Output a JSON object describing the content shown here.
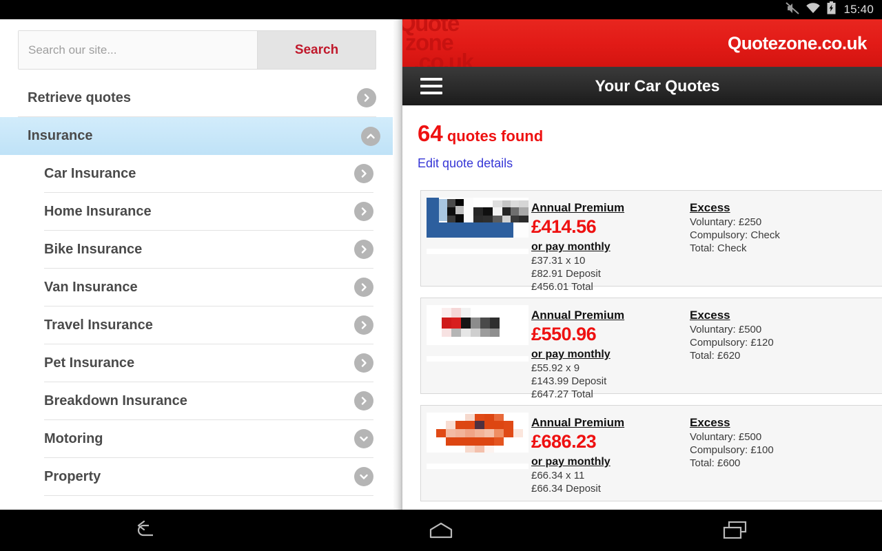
{
  "status_bar": {
    "time": "15:40",
    "icons": [
      "mute-icon",
      "wifi-icon",
      "battery-charging-icon"
    ]
  },
  "sidebar": {
    "search": {
      "placeholder": "Search our site...",
      "value": "",
      "button_label": "Search"
    },
    "items": [
      {
        "label": "Retrieve quotes",
        "icon": "chevron-right-icon",
        "level": "top",
        "active": false
      },
      {
        "label": "Insurance",
        "icon": "chevron-up-icon",
        "level": "top",
        "active": true
      },
      {
        "label": "Car Insurance",
        "icon": "chevron-right-icon",
        "level": "sub",
        "active": false
      },
      {
        "label": "Home Insurance",
        "icon": "chevron-right-icon",
        "level": "sub",
        "active": false
      },
      {
        "label": "Bike Insurance",
        "icon": "chevron-right-icon",
        "level": "sub",
        "active": false
      },
      {
        "label": "Van Insurance",
        "icon": "chevron-right-icon",
        "level": "sub",
        "active": false
      },
      {
        "label": "Travel Insurance",
        "icon": "chevron-right-icon",
        "level": "sub",
        "active": false
      },
      {
        "label": "Pet Insurance",
        "icon": "chevron-right-icon",
        "level": "sub",
        "active": false
      },
      {
        "label": "Breakdown Insurance",
        "icon": "chevron-right-icon",
        "level": "sub",
        "active": false
      },
      {
        "label": "Motoring",
        "icon": "chevron-down-icon",
        "level": "sub",
        "active": false
      },
      {
        "label": "Property",
        "icon": "chevron-down-icon",
        "level": "sub",
        "active": false
      }
    ]
  },
  "header": {
    "brand": "Quotezone.co.uk",
    "watermark_line1": "Quote",
    "watermark_line2": "zone",
    "watermark_line3": ".co.uk",
    "menu_icon": "hamburger-menu-icon",
    "title": "Your Car Quotes"
  },
  "results": {
    "count": "64",
    "count_suffix": " quotes found",
    "edit_link": "Edit quote details"
  },
  "quotes": [
    {
      "logo": "insurer-logo-blurred-blue",
      "premium_label": "Annual Premium",
      "price": "£414.56",
      "monthly_label": "or pay monthly",
      "monthly_instalments": "£37.31 x 10",
      "deposit": "£82.91 Deposit",
      "total": "£456.01 Total",
      "excess_label": "Excess",
      "voluntary": "Voluntary: £250",
      "compulsory": "Compulsory: Check",
      "excess_total": "Total: Check"
    },
    {
      "logo": "insurer-logo-blurred-red",
      "premium_label": "Annual Premium",
      "price": "£550.96",
      "monthly_label": "or pay monthly",
      "monthly_instalments": "£55.92 x 9",
      "deposit": "£143.99 Deposit",
      "total": "£647.27 Total",
      "excess_label": "Excess",
      "voluntary": "Voluntary: £500",
      "compulsory": "Compulsory: £120",
      "excess_total": "Total: £620"
    },
    {
      "logo": "insurer-logo-blurred-orange",
      "premium_label": "Annual Premium",
      "price": "£686.23",
      "monthly_label": "or pay monthly",
      "monthly_instalments": "£66.34 x 11",
      "deposit": "£66.34 Deposit",
      "total": "",
      "excess_label": "Excess",
      "voluntary": "Voluntary: £500",
      "compulsory": "Compulsory: £100",
      "excess_total": "Total: £600"
    }
  ],
  "android_nav": {
    "back": "back-icon",
    "home": "home-icon",
    "recents": "recents-icon"
  },
  "colors": {
    "brand_red": "#e21b17",
    "price_red": "#ee1111",
    "link_blue": "#3636d6",
    "active_blue": "#c9e7fa"
  }
}
